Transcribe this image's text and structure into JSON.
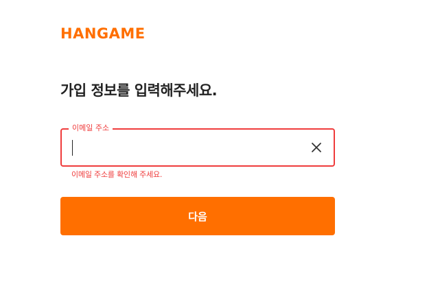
{
  "brand": {
    "logo_text": "HANGAME",
    "color": "#ff6f00"
  },
  "page": {
    "title": "가입 정보를 입력해주세요."
  },
  "email_field": {
    "label": "이메일 주소",
    "value": "",
    "error": "이메일 주소를 확인해 주세요.",
    "error_color": "#ef3b3b",
    "clear_icon": "close-icon"
  },
  "actions": {
    "next_label": "다음",
    "next_color": "#ff6f00"
  }
}
